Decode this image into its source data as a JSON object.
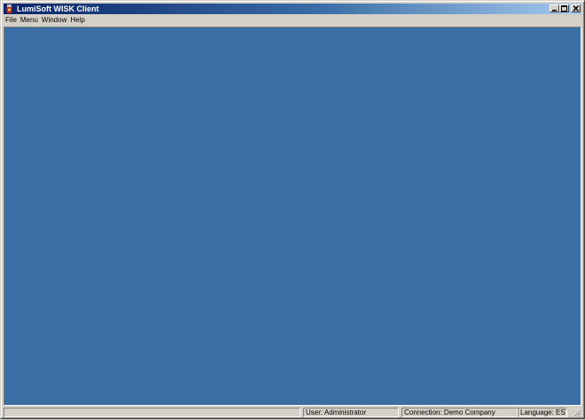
{
  "window": {
    "title": "LumiSoft WISK Client",
    "icon": "app-icon",
    "controls": [
      "minimize-icon",
      "maximize-icon",
      "close-icon"
    ]
  },
  "menu": {
    "items": [
      {
        "label": "File"
      },
      {
        "label": "Menu"
      },
      {
        "label": "Window"
      },
      {
        "label": "Help"
      }
    ]
  },
  "workspace": {
    "background": "#3a6ea5"
  },
  "statusbar": {
    "main": "",
    "user": "User: Administrator",
    "connection": "Connection: Demo Company",
    "language": "Language: EST"
  },
  "colors": {
    "title_active": "#0a246a",
    "title_gradient_end": "#a6caf0",
    "chrome": "#d4d0c8"
  }
}
